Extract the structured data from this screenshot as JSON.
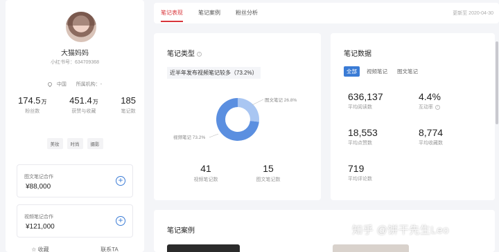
{
  "profile": {
    "nickname": "大猫妈妈",
    "red_id": "小红书号：634709368",
    "location": "中国",
    "org": "所属机构：-",
    "stats": [
      {
        "num": "174.5",
        "unit": "万",
        "label": "粉丝数"
      },
      {
        "num": "451.4",
        "unit": "万",
        "label": "获赞与收藏"
      },
      {
        "num": "185",
        "unit": "",
        "label": "笔记数"
      }
    ],
    "tags": [
      "美妆",
      "时尚",
      "摄影"
    ],
    "coops": [
      {
        "title": "图文笔记合作",
        "price": "¥88,000"
      },
      {
        "title": "视频笔记合作",
        "price": "¥121,000"
      }
    ],
    "actions": [
      "☆ 收藏",
      "联系TA"
    ]
  },
  "topbar": {
    "tabs": [
      "笔记表现",
      "笔记案例",
      "粉丝分析"
    ],
    "date": "更新至 2020-04-30"
  },
  "note_type": {
    "title": "笔记类型",
    "summary": "近半年发布视频笔记较多（73.2%）",
    "video_label": "视频笔记 73.2%",
    "image_label": "图文笔记 26.8%",
    "video_count": "41",
    "video_count_label": "视频笔记数",
    "image_count": "15",
    "image_count_label": "图文笔记数",
    "colors": {
      "video": "#5b8fe0",
      "image": "#a9c6f2"
    }
  },
  "chart_data": {
    "type": "pie",
    "categories": [
      "视频笔记",
      "图文笔记"
    ],
    "values": [
      73.2,
      26.8
    ]
  },
  "note_data": {
    "title": "笔记数据",
    "filters": [
      "全部",
      "视频笔记",
      "图文笔记"
    ],
    "metrics": [
      {
        "num": "636,137",
        "label": "平均阅读数"
      },
      {
        "num": "4.4%",
        "label": "互动率"
      },
      {
        "num": "18,553",
        "label": "平均点赞数"
      },
      {
        "num": "8,774",
        "label": "平均收藏数"
      },
      {
        "num": "719",
        "label": "平均评论数"
      }
    ]
  },
  "cases": {
    "title": "笔记案例"
  },
  "watermark": "知乎 @饼干先生Leo"
}
